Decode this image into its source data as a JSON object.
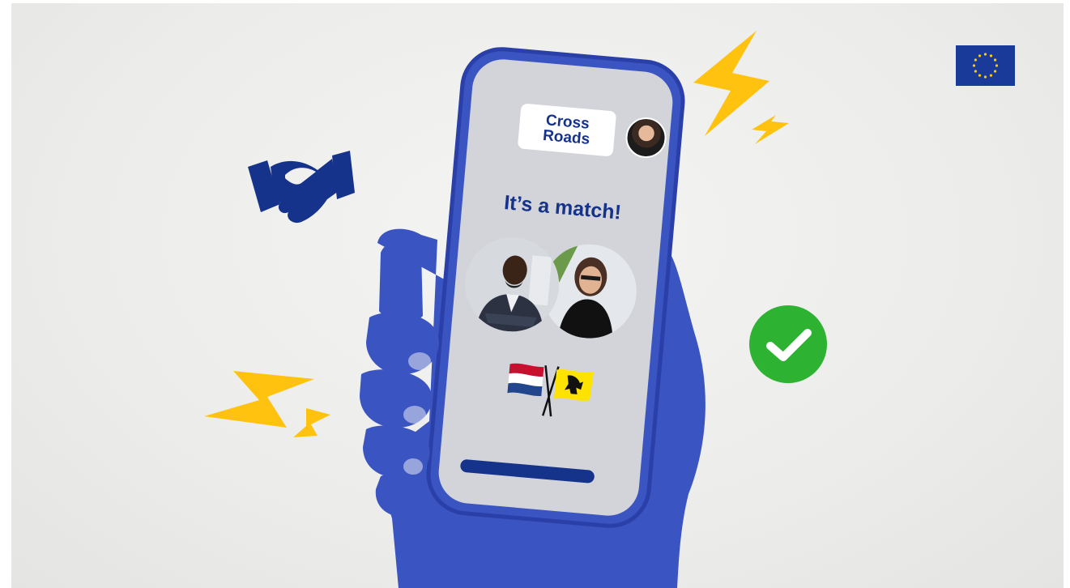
{
  "app": {
    "logo_line1": "Cross",
    "logo_line2": "Roads"
  },
  "screen": {
    "headline": "It’s a match!"
  },
  "icons": {
    "handshake": "handshake-icon",
    "lightning": "lightning-icon",
    "check": "checkmark-icon",
    "eu_flag": "eu-flag-icon",
    "dutch_flag": "netherlands-flag-icon",
    "flemish_flag": "flanders-flag-icon"
  },
  "colors": {
    "brand_blue": "#16338c",
    "hand_blue": "#3a54c2",
    "lightning_yellow": "#ffc20e",
    "check_green": "#2db331",
    "screen_gray": "#d2d4da"
  }
}
